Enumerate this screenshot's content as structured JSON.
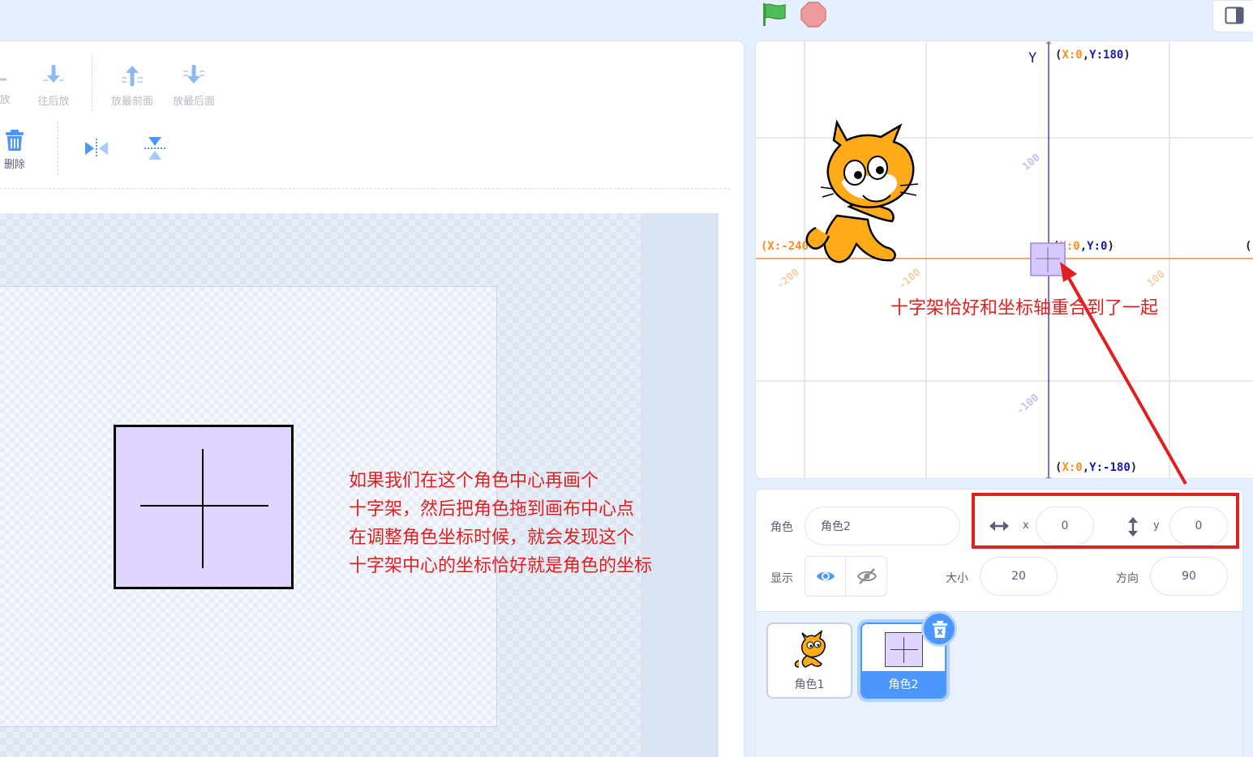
{
  "toolbar": {
    "forward_label": "放",
    "backward_label": "往后放",
    "front_label": "放最前面",
    "back_label": "放最后面",
    "delete_label": "删除"
  },
  "paint_note": "如果我们在这个角色中心再画个\n十字架，然后把角色拖到画布中心点\n在调整角色坐标时候，就会发现这个\n十字架中心的坐标恰好就是角色的坐标",
  "stage": {
    "y_axis_label": "Y",
    "top_coord": {
      "x_part": "X:0",
      "y_part": "Y:180"
    },
    "bottom_coord": {
      "x_part": "X:0",
      "y_part": "Y:-180"
    },
    "center_coord": {
      "x_part": "X:0",
      "y_part": "Y:0"
    },
    "left_coord": "(X:-240",
    "right_coord_fragment": "(",
    "tick_labels": [
      "100",
      "-200",
      "-100",
      "100",
      "-100"
    ],
    "note": "十字架恰好和坐标轴重合到了一起"
  },
  "sprite_info": {
    "sprite_label": "角色",
    "name_value": "角色2",
    "x_label": "x",
    "x_value": "0",
    "y_label": "y",
    "y_value": "0",
    "show_label": "显示",
    "size_label": "大小",
    "size_value": "20",
    "direction_label": "方向",
    "direction_value": "90"
  },
  "sprites": [
    {
      "name": "角色1",
      "selected": false
    },
    {
      "name": "角色2",
      "selected": true
    }
  ],
  "colors": {
    "accent": "#4c97ff",
    "annotation": "#e02020",
    "costume_fill": "#e1d4ff",
    "x_axis": "#ff8c1a",
    "y_axis": "#0000aa"
  }
}
